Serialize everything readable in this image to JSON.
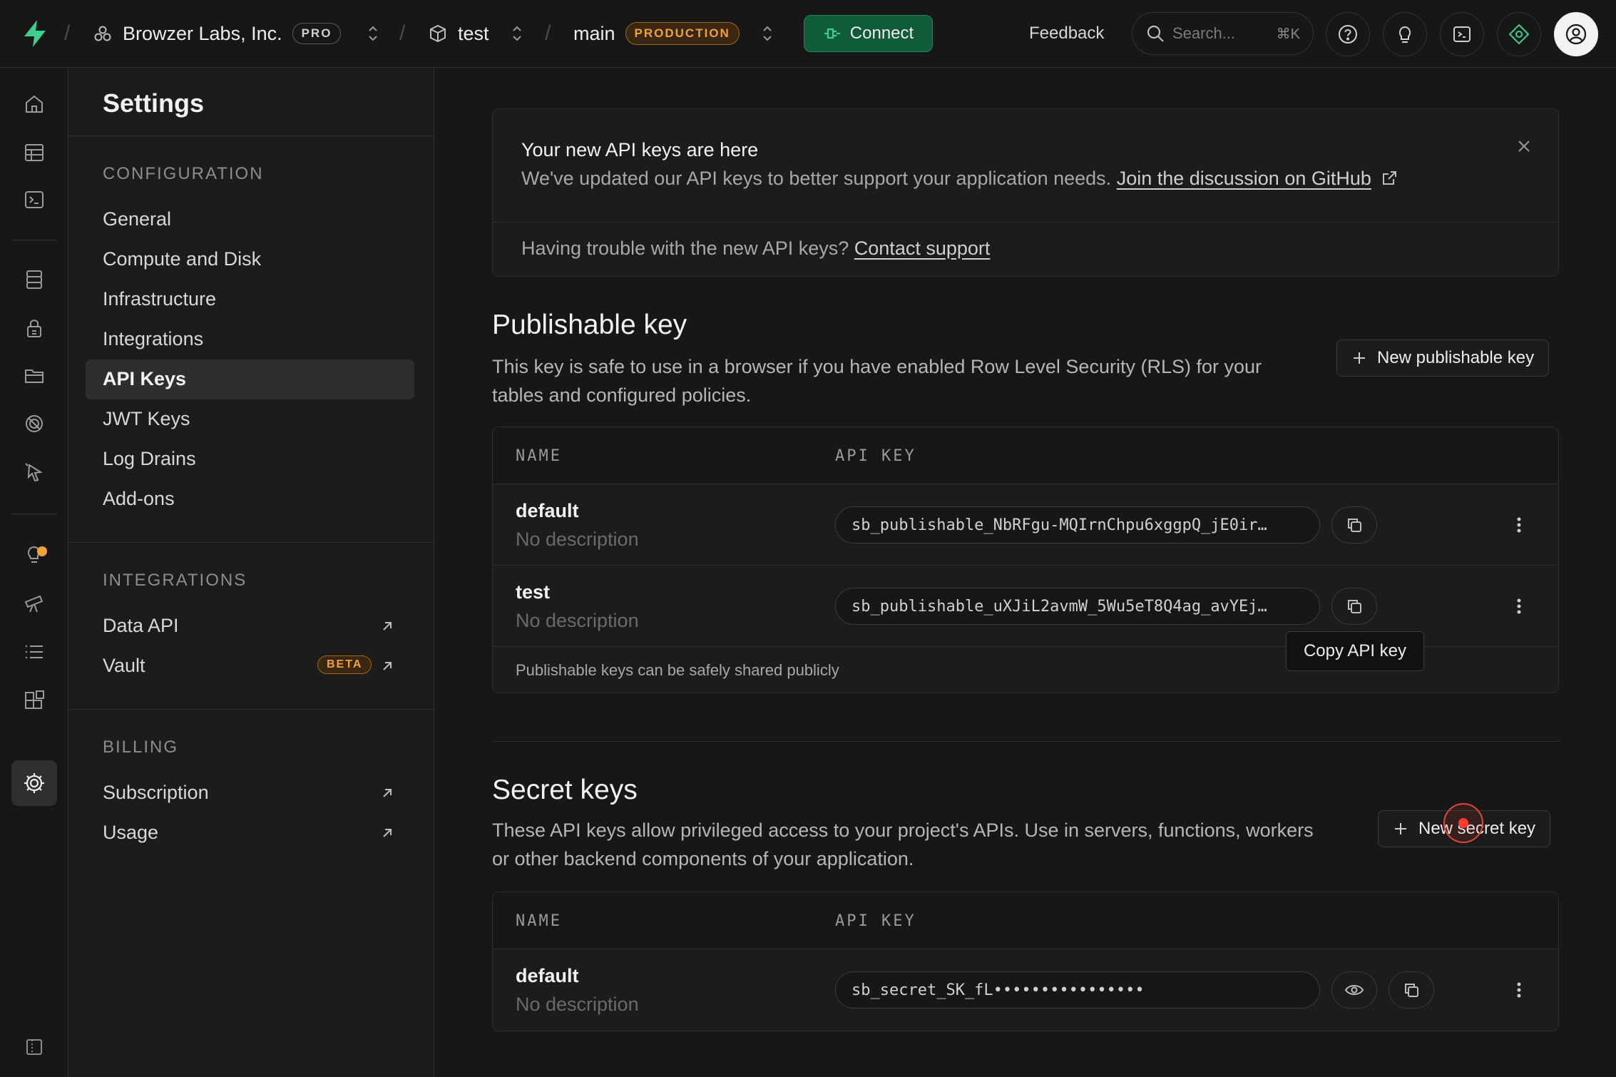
{
  "topbar": {
    "org_name": "Browzer Labs, Inc.",
    "org_plan": "PRO",
    "project_name": "test",
    "branch_name": "main",
    "branch_badge": "PRODUCTION",
    "connect_label": "Connect",
    "feedback_label": "Feedback",
    "search_placeholder": "Search...",
    "search_shortcut": "⌘K"
  },
  "rail": {
    "icons": [
      "home-icon",
      "table-editor-icon",
      "sql-editor-icon",
      "database-icon",
      "auth-icon",
      "storage-icon",
      "realtime-icon",
      "edge-functions-icon",
      "advisors-icon",
      "reports-icon",
      "logs-icon",
      "integrations-icon",
      "settings-icon",
      "collapse-sidebar-icon"
    ],
    "active": "settings-icon"
  },
  "sidebar": {
    "title": "Settings",
    "configuration": {
      "heading": "CONFIGURATION",
      "items": [
        "General",
        "Compute and Disk",
        "Infrastructure",
        "Integrations",
        "API Keys",
        "JWT Keys",
        "Log Drains",
        "Add-ons"
      ],
      "active": "API Keys"
    },
    "integrations": {
      "heading": "INTEGRATIONS",
      "items": [
        "Data API",
        "Vault"
      ],
      "vault_badge": "BETA"
    },
    "billing": {
      "heading": "BILLING",
      "items": [
        "Subscription",
        "Usage"
      ]
    }
  },
  "banner": {
    "title": "Your new API keys are here",
    "text": "We've updated our API keys to better support your application needs.",
    "link": "Join the discussion on GitHub",
    "footer_text": "Having trouble with the new API keys?",
    "footer_link": "Contact support"
  },
  "publishable": {
    "heading": "Publishable key",
    "description_line1": "This key is safe to use in a browser if you have enabled Row Level Security (RLS) for your",
    "description_line2": "tables and configured policies.",
    "new_button": "New publishable key",
    "col_name": "NAME",
    "col_key": "API KEY",
    "rows": [
      {
        "name": "default",
        "description": "No description",
        "key": "sb_publishable_NbRFgu-MQIrnChpu6xggpQ_jE0ir…"
      },
      {
        "name": "test",
        "description": "No description",
        "key": "sb_publishable_uXJiL2avmW_5Wu5eT8Q4ag_avYEj…"
      }
    ],
    "footer": "Publishable keys can be safely shared publicly",
    "tooltip": "Copy API key"
  },
  "secret": {
    "heading": "Secret keys",
    "description_line1": "These API keys allow privileged access to your project's APIs. Use in servers, functions, workers",
    "description_line2": "or other backend components of your application.",
    "new_button": "New secret key",
    "col_name": "NAME",
    "col_key": "API KEY",
    "rows": [
      {
        "name": "default",
        "description": "No description",
        "key": "sb_secret_SK_fL••••••••••••••••"
      }
    ]
  },
  "colors": {
    "accent_green": "#0f5b3a",
    "badge_orange": "#f0a23a",
    "background": "#171717"
  }
}
